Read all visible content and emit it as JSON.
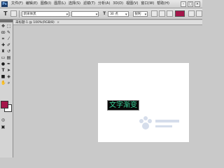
{
  "menubar": {
    "logo": "Ps",
    "items": [
      "文件(F)",
      "编辑(E)",
      "图像(I)",
      "图层(L)",
      "选择(S)",
      "滤镜(T)",
      "分析(A)",
      "3D(D)",
      "视图(V)",
      "窗口(W)",
      "帮助(H)"
    ],
    "window_controls": [
      "minimize",
      "restore",
      "close"
    ]
  },
  "optionsbar": {
    "tool_icon": "type-tool-icon",
    "font_family": "新宋体黑",
    "font_style": "",
    "font_size": "30 点",
    "antialias": "锐利",
    "text_color": "#a5164a"
  },
  "document": {
    "tab_title": "未标题-1 @ 100%(RGB/8)"
  },
  "toolbox": {
    "tools": [
      "move-tool-icon",
      "marquee-tool-icon",
      "lasso-tool-icon",
      "quick-select-tool-icon",
      "crop-tool-icon",
      "eyedropper-tool-icon",
      "healing-tool-icon",
      "brush-tool-icon",
      "clone-stamp-tool-icon",
      "history-brush-tool-icon",
      "eraser-tool-icon",
      "gradient-tool-icon",
      "dodge-tool-icon",
      "pen-tool-icon",
      "type-tool-icon",
      "path-select-tool-icon",
      "shape-tool-icon",
      "hand-tool-icon",
      "zoom-tool-icon"
    ],
    "foreground_color": "#a5164a",
    "background_color": "#ffffff"
  },
  "canvas": {
    "text": "文字渐变",
    "text_color": "#39d49a",
    "text_bg": "#0a0a0a"
  }
}
